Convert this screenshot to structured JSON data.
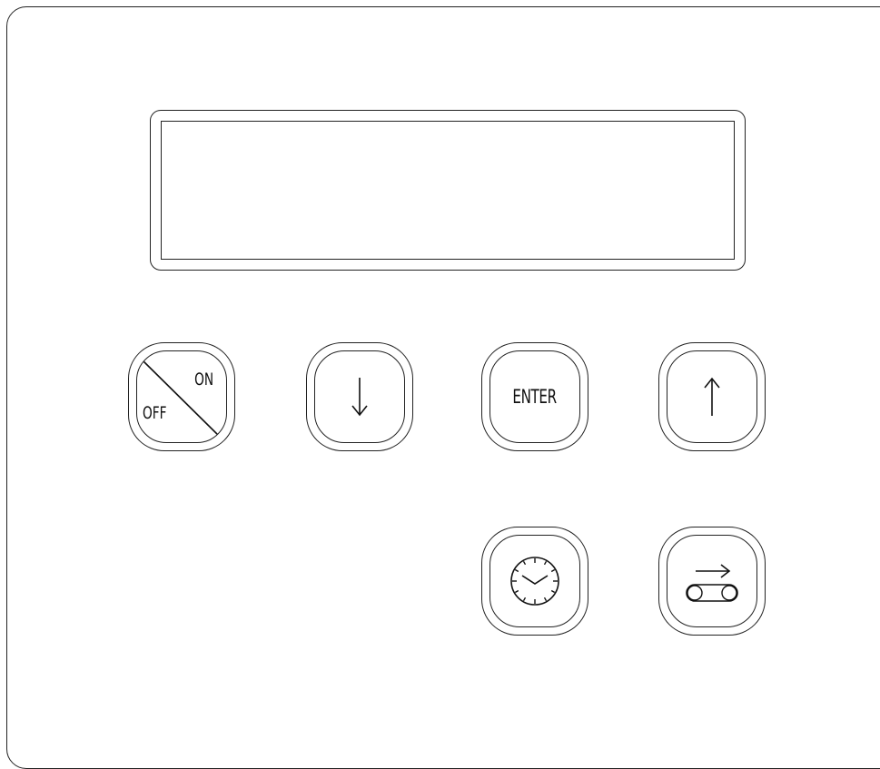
{
  "panel": {
    "display": {
      "text": ""
    },
    "keys": {
      "power": {
        "on_label": "ON",
        "off_label": "OFF",
        "icon": "power-toggle-icon"
      },
      "down": {
        "icon": "arrow-down-icon"
      },
      "enter": {
        "label": "ENTER"
      },
      "up": {
        "icon": "arrow-up-icon"
      },
      "timer": {
        "icon": "clock-icon"
      },
      "conveyor": {
        "icon": "conveyor-icon"
      }
    }
  }
}
